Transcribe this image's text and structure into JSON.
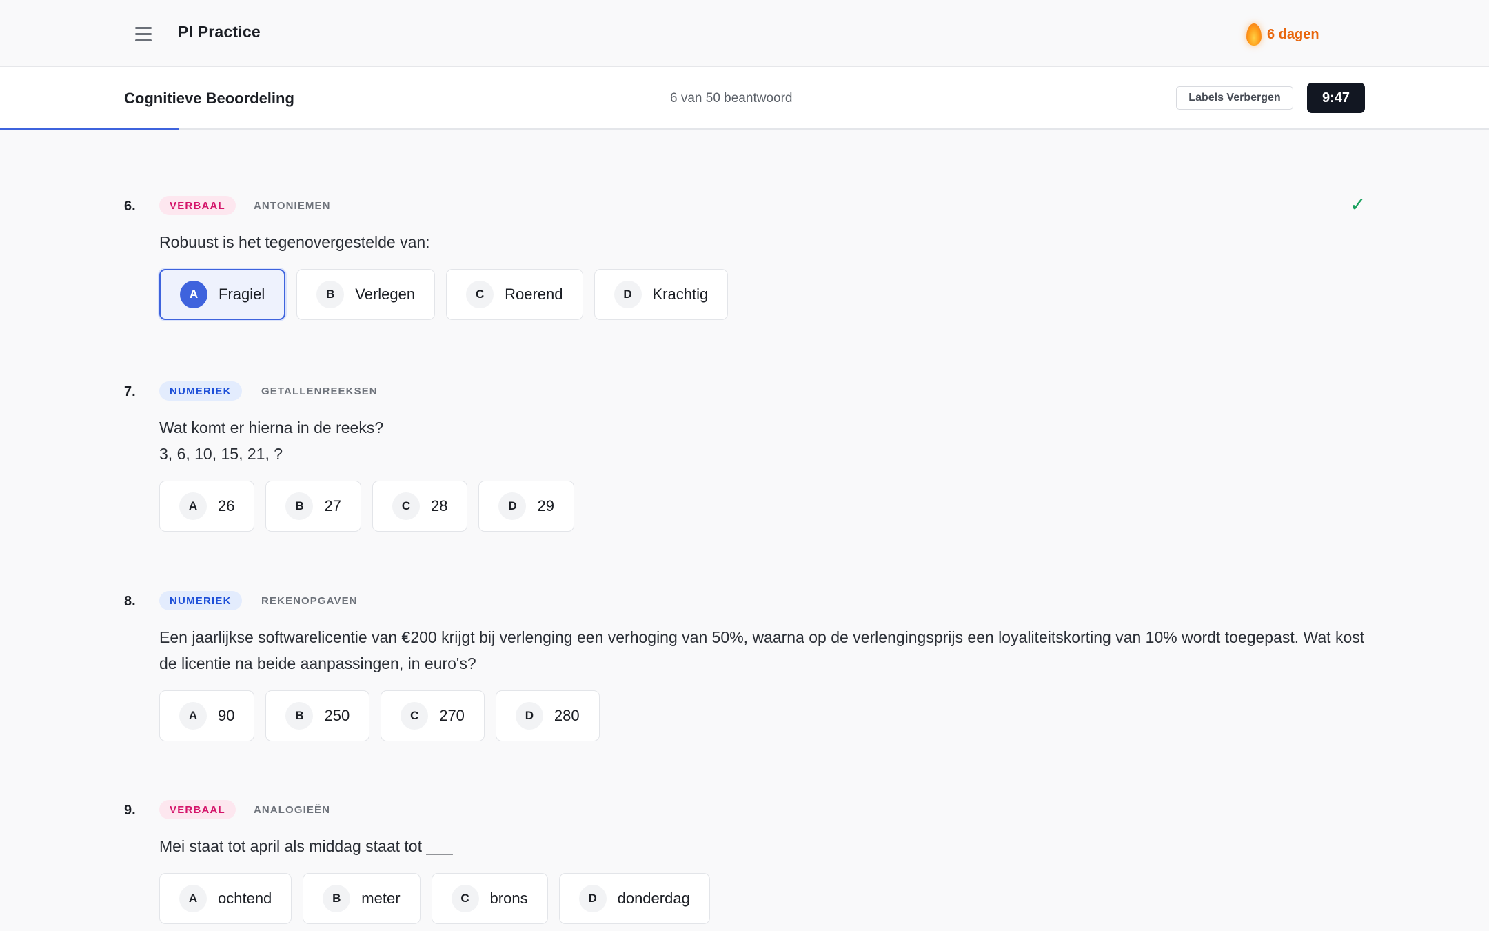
{
  "app": {
    "title": "PI Practice",
    "streak_label": "6 dagen"
  },
  "quiz": {
    "title": "Cognitieve Beoordeling",
    "answered_label": "6 van 50 beantwoord",
    "answered_count": 6,
    "total_questions": 50,
    "progress_fraction": 0.12,
    "labels_button": "Labels Verbergen",
    "timer": "9:47"
  },
  "colors": {
    "accent": "#3e63dd",
    "verbaal": "#d4146a",
    "numeriek": "#1d4fd8",
    "streak": "#e8660c",
    "check": "#17a05c"
  },
  "questions": [
    {
      "number": "6.",
      "category": "VERBAAL",
      "subcategory": "ANTONIEMEN",
      "answered": true,
      "text": "Robuust is het tegenovergestelde van:",
      "text_line2": "",
      "selected": "A",
      "options": [
        {
          "letter": "A",
          "text": "Fragiel"
        },
        {
          "letter": "B",
          "text": "Verlegen"
        },
        {
          "letter": "C",
          "text": "Roerend"
        },
        {
          "letter": "D",
          "text": "Krachtig"
        }
      ]
    },
    {
      "number": "7.",
      "category": "NUMERIEK",
      "subcategory": "GETALLENREEKSEN",
      "answered": false,
      "text": "Wat komt er hierna in de reeks?",
      "text_line2": "3, 6, 10, 15, 21, ?",
      "selected": null,
      "options": [
        {
          "letter": "A",
          "text": "26"
        },
        {
          "letter": "B",
          "text": "27"
        },
        {
          "letter": "C",
          "text": "28"
        },
        {
          "letter": "D",
          "text": "29"
        }
      ]
    },
    {
      "number": "8.",
      "category": "NUMERIEK",
      "subcategory": "REKENOPGAVEN",
      "answered": false,
      "text": "Een jaarlijkse softwarelicentie van €200 krijgt bij verlenging een verhoging van 50%, waarna op de verlengingsprijs een loyaliteitskorting van 10% wordt toegepast. Wat kost de licentie na beide aanpassingen, in euro's?",
      "text_line2": "",
      "selected": null,
      "options": [
        {
          "letter": "A",
          "text": "90"
        },
        {
          "letter": "B",
          "text": "250"
        },
        {
          "letter": "C",
          "text": "270"
        },
        {
          "letter": "D",
          "text": "280"
        }
      ]
    },
    {
      "number": "9.",
      "category": "VERBAAL",
      "subcategory": "ANALOGIEËN",
      "answered": false,
      "text": "Mei staat tot april als middag staat tot ___",
      "text_line2": "",
      "selected": null,
      "options": [
        {
          "letter": "A",
          "text": "ochtend"
        },
        {
          "letter": "B",
          "text": "meter"
        },
        {
          "letter": "C",
          "text": "brons"
        },
        {
          "letter": "D",
          "text": "donderdag"
        }
      ]
    }
  ]
}
